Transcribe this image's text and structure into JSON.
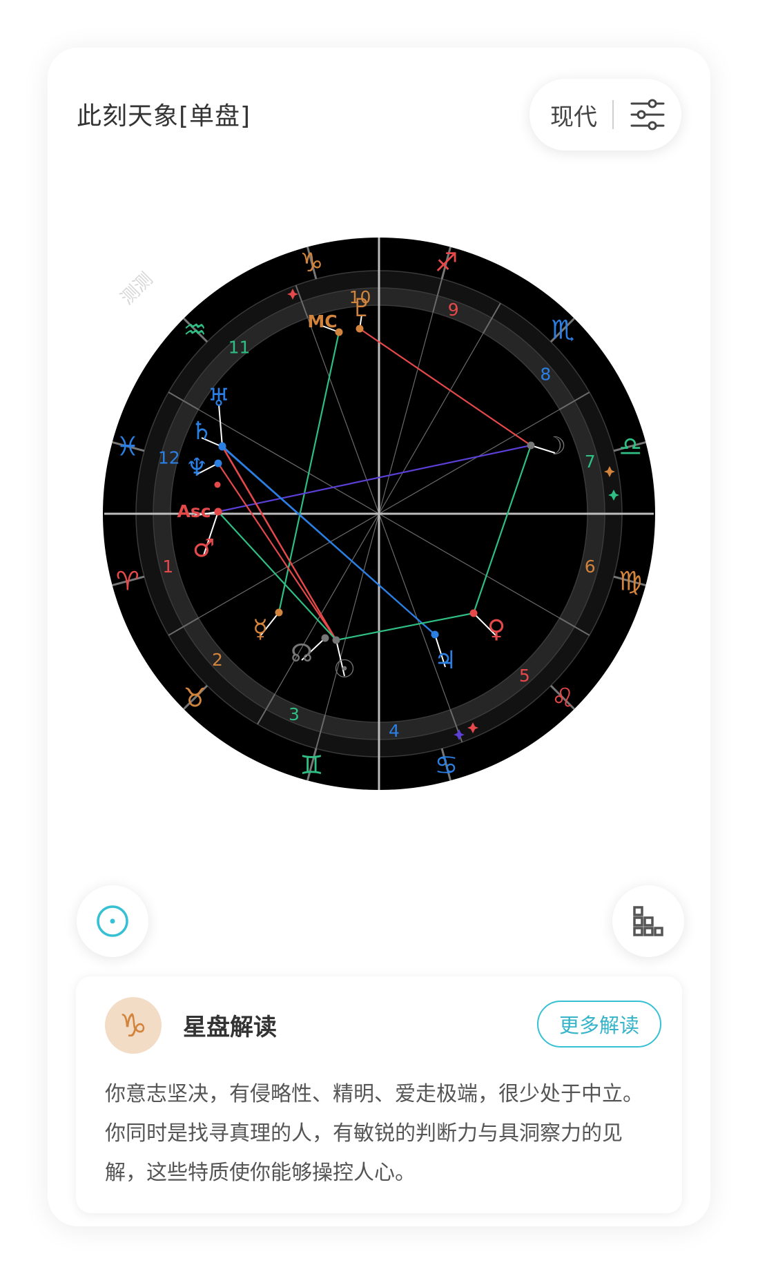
{
  "header": {
    "title": "此刻天象[单盘]",
    "mode_label": "现代",
    "watermark": "测测"
  },
  "chart": {
    "signs": [
      {
        "name": "aries",
        "glyph": "♈",
        "color": "#e5494a"
      },
      {
        "name": "taurus",
        "glyph": "♉",
        "color": "#d2843c"
      },
      {
        "name": "gemini",
        "glyph": "♊",
        "color": "#2fbf84"
      },
      {
        "name": "cancer",
        "glyph": "♋",
        "color": "#2b7fe3"
      },
      {
        "name": "leo",
        "glyph": "♌",
        "color": "#e5494a"
      },
      {
        "name": "virgo",
        "glyph": "♍",
        "color": "#d2843c"
      },
      {
        "name": "libra",
        "glyph": "♎",
        "color": "#2fbf84"
      },
      {
        "name": "scorpio",
        "glyph": "♏",
        "color": "#2b7fe3"
      },
      {
        "name": "sagittarius",
        "glyph": "♐",
        "color": "#e5494a"
      },
      {
        "name": "capricorn",
        "glyph": "♑",
        "color": "#d2843c"
      },
      {
        "name": "aquarius",
        "glyph": "♒",
        "color": "#2fbf84"
      },
      {
        "name": "pisces",
        "glyph": "♓",
        "color": "#2b7fe3"
      }
    ],
    "houses": [
      {
        "n": "1",
        "color": "#e5494a"
      },
      {
        "n": "2",
        "color": "#d2843c"
      },
      {
        "n": "3",
        "color": "#2fbf84"
      },
      {
        "n": "4",
        "color": "#2b7fe3"
      },
      {
        "n": "5",
        "color": "#e5494a"
      },
      {
        "n": "6",
        "color": "#d2843c"
      },
      {
        "n": "7",
        "color": "#2fbf84"
      },
      {
        "n": "8",
        "color": "#2b7fe3"
      },
      {
        "n": "9",
        "color": "#e5494a"
      },
      {
        "n": "10",
        "color": "#d2843c"
      },
      {
        "n": "11",
        "color": "#2fbf84"
      },
      {
        "n": "12",
        "color": "#2b7fe3"
      }
    ],
    "planets": [
      {
        "name": "pluto",
        "glyph": "♇",
        "color": "#d2843c"
      },
      {
        "name": "mc",
        "glyph": "MC",
        "color": "#d2843c"
      },
      {
        "name": "moon",
        "glyph": "☽",
        "color": "#777777"
      },
      {
        "name": "uranus",
        "glyph": "♅",
        "color": "#2b7fe3"
      },
      {
        "name": "saturn",
        "glyph": "♄",
        "color": "#2b7fe3"
      },
      {
        "name": "neptune",
        "glyph": "♆",
        "color": "#2b7fe3"
      },
      {
        "name": "asc",
        "glyph": "Asc",
        "color": "#e5494a"
      },
      {
        "name": "mars",
        "glyph": "♂",
        "color": "#e5494a"
      },
      {
        "name": "mercury",
        "glyph": "☿",
        "color": "#d2843c"
      },
      {
        "name": "node",
        "glyph": "☊",
        "color": "#777777"
      },
      {
        "name": "sun",
        "glyph": "☉",
        "color": "#777777"
      },
      {
        "name": "jupiter",
        "glyph": "♃",
        "color": "#2b7fe3"
      },
      {
        "name": "venus",
        "glyph": "♀",
        "color": "#e5494a"
      }
    ],
    "aspect_colors": {
      "red": "#e5494a",
      "green": "#2fbf84",
      "blue": "#2b7fe3",
      "purple": "#5b3fd6"
    }
  },
  "interpretation": {
    "title": "星盘解读",
    "sign_glyph": "♑",
    "sign_color": "#d2843c",
    "more_label": "更多解读",
    "text": "你意志坚决，有侵略性、精明、爱走极端，很少处于中立。你同时是找寻真理的人，有敏锐的判断力与具洞察力的见解，这些特质使你能够操控人心。"
  },
  "icons": {
    "settings": "sliders-icon",
    "sun_button": "sun-icon",
    "house_button": "house-system-icon"
  },
  "colors": {
    "accent": "#35c0d3"
  }
}
